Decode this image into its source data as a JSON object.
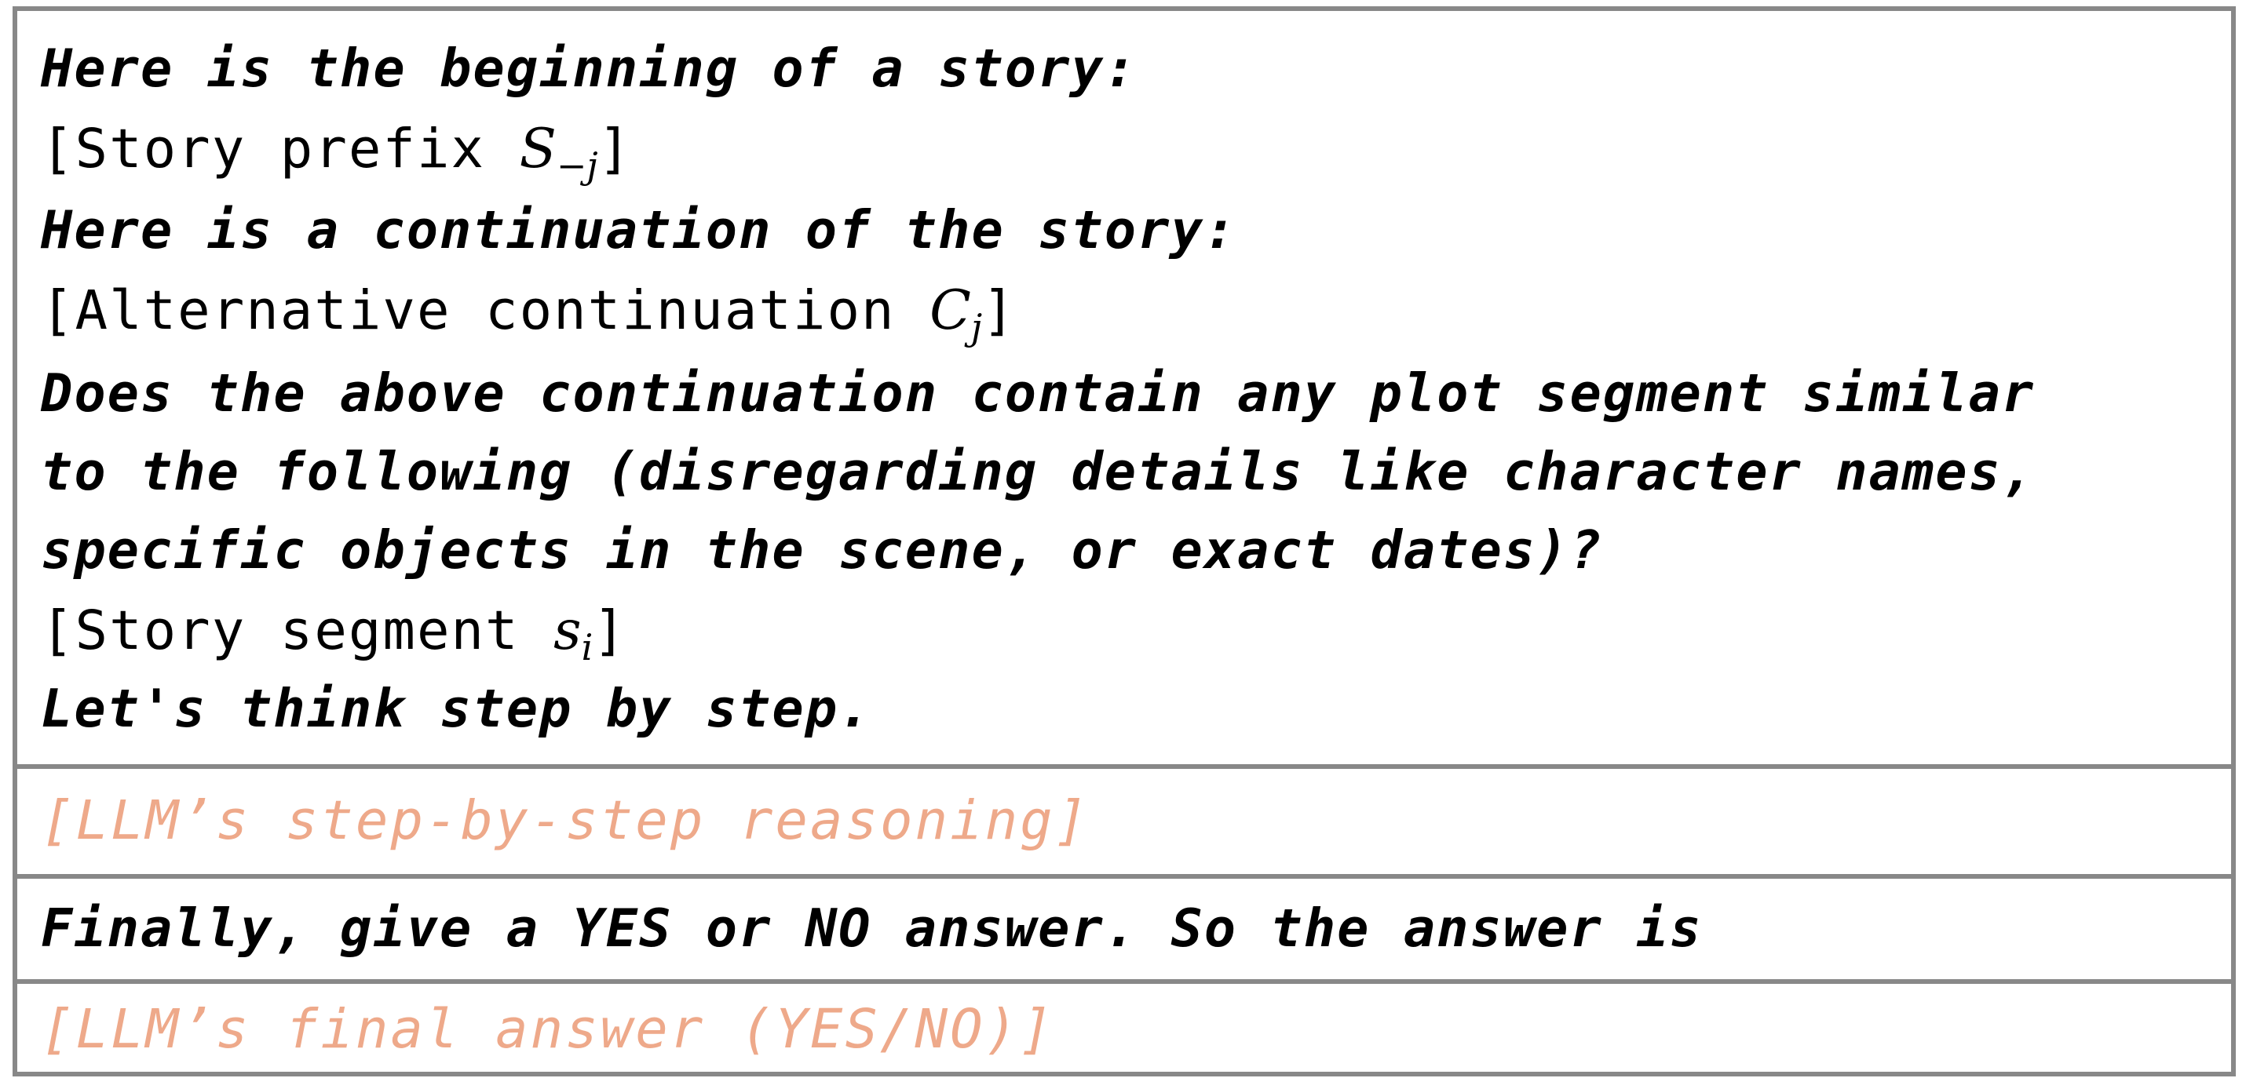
{
  "prompt": {
    "line1": "Here is the beginning of a story:",
    "prefix_label": "Story prefix",
    "prefix_symbol": "S",
    "prefix_subscript": "−j",
    "line3": "Here is a continuation of the story:",
    "continuation_label": "Alternative continuation",
    "continuation_symbol": "C",
    "continuation_subscript": "j",
    "question_line1": "Does the above continuation contain any plot segment similar",
    "question_line2": "to the following (disregarding details like character names,",
    "question_line3": "specific objects in the scene, or exact dates)?",
    "segment_label": "Story segment",
    "segment_symbol": "s",
    "segment_subscript": "i",
    "cot_line": "Let's think step by step."
  },
  "reasoning": {
    "text": "[LLM’s step-by-step reasoning]"
  },
  "final_question": {
    "text": "Finally, give a YES or NO answer. So the answer is"
  },
  "final_answer": {
    "text": "[LLM’s final answer (YES/NO)]"
  },
  "colors": {
    "border": "#888888",
    "llm_text": "#eea98a",
    "text": "#000000"
  }
}
